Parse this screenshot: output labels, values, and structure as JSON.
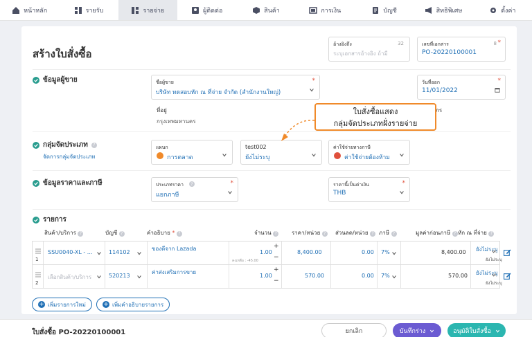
{
  "nav": {
    "items": [
      {
        "label": "หน้าหลัก",
        "icon": "home-icon"
      },
      {
        "label": "รายรับ",
        "icon": "income-icon"
      },
      {
        "label": "รายจ่าย",
        "icon": "expense-icon"
      },
      {
        "label": "ผู้ติดต่อ",
        "icon": "contacts-icon"
      },
      {
        "label": "สินค้า",
        "icon": "product-icon"
      },
      {
        "label": "การเงิน",
        "icon": "finance-icon"
      },
      {
        "label": "บัญชี",
        "icon": "accounting-icon"
      },
      {
        "label": "สิทธิพิเศษ",
        "icon": "megaphone-icon"
      },
      {
        "label": "ตั้งค่า",
        "icon": "gear-icon"
      }
    ]
  },
  "page": {
    "title": "สร้างใบสั่งซื้อ",
    "reference": {
      "label": "อ้างอิงถึง",
      "placeholder": "ระบุเอกสารอ้างอิง ถ้ามี",
      "counter": "32"
    },
    "doc_number": {
      "label": "เลขที่เอกสาร",
      "value": "PO-20220100001",
      "counter": "8"
    }
  },
  "vendor": {
    "section": "ข้อมูลผู้ขาย",
    "name_label": "ชื่อผู้ขาย",
    "name_value": "บริษัท ทดสอบหัก ณ ที่จ่าย จำกัด (สำนักงานใหญ่)",
    "address_label": "ที่อยู่",
    "address_value": "กรุงเทพมหานคร",
    "date_label": "วันที่ออก",
    "date_value": "11/01/2022",
    "partial_label": "กร"
  },
  "category": {
    "section": "กลุ่มจัดประเภท",
    "manage_link": "จัดการกลุ่มจัดประเภท",
    "dept_label": "แผนก",
    "dept_value": "การตลาด",
    "test_label": "test002",
    "test_placeholder": "ยังไม่ระบุ",
    "expense_label": "ค่าใช้จ่ายทางภาษี",
    "expense_value": "ค่าใช้จ่ายต้องห้าม"
  },
  "callout": {
    "line1": "ใบสั่งซื้อแสดง",
    "line2": "กลุ่มจัดประเภทฝั่งรายจ่าย"
  },
  "pricing": {
    "section": "ข้อมูลราคาและภาษี",
    "price_type_label": "ประเภทราคา",
    "price_type_value": "แยกภาษี",
    "currency_label": "ราคานี้เป็นค่าเงิน",
    "currency_value": "THB"
  },
  "items": {
    "section": "รายการ",
    "headers": {
      "product": "สินค้า/บริการ",
      "account": "บัญชี",
      "description": "คำอธิบาย",
      "qty": "จำนวน",
      "price": "ราคา/หน่วย",
      "discount": "ส่วนลด/หน่วย",
      "tax": "ภาษี",
      "amount": "มูลค่าก่อนภาษี",
      "wht": "หัก ณ ที่จ่าย"
    },
    "rows": [
      {
        "index": "1",
        "product": "SSU0040-XL - ...",
        "account": "114102",
        "description": "ของดีจาก Lazada",
        "qty": "1.00",
        "stock": "คงเหลือ : -45.00",
        "price": "8,400.00",
        "discount": "0.00",
        "tax": "7%",
        "amount": "8,400.00",
        "wht": "ยังไม่ระบุ",
        "wht_sub": "ยังไม่ระบุ"
      },
      {
        "index": "2",
        "product": "เลือกสินค้า/บริการ",
        "account": "520213",
        "description": "ค่าส่งเสริมการขาย",
        "qty": "1.00",
        "stock": "",
        "price": "570.00",
        "discount": "0.00",
        "tax": "7%",
        "amount": "570.00",
        "wht": "ยังไม่ระบุ",
        "wht_sub": "ยังไม่ระบุ"
      }
    ],
    "add_item": "เพิ่มรายการใหม่",
    "add_desc": "เพิ่มคำอธิบายรายการ"
  },
  "footer": {
    "doc": "ใบสั่งซื้อ PO-20220100001",
    "cancel": "ยกเลิก",
    "save_draft": "บันทึกร่าง",
    "approve": "อนุมัติใบสั่งซื้อ"
  },
  "colors": {
    "accent": "#1f6fb5",
    "success": "#2a9d8f",
    "purple": "#6b5bd2",
    "teal": "#2bb6b0",
    "callout": "#f08a2a"
  }
}
